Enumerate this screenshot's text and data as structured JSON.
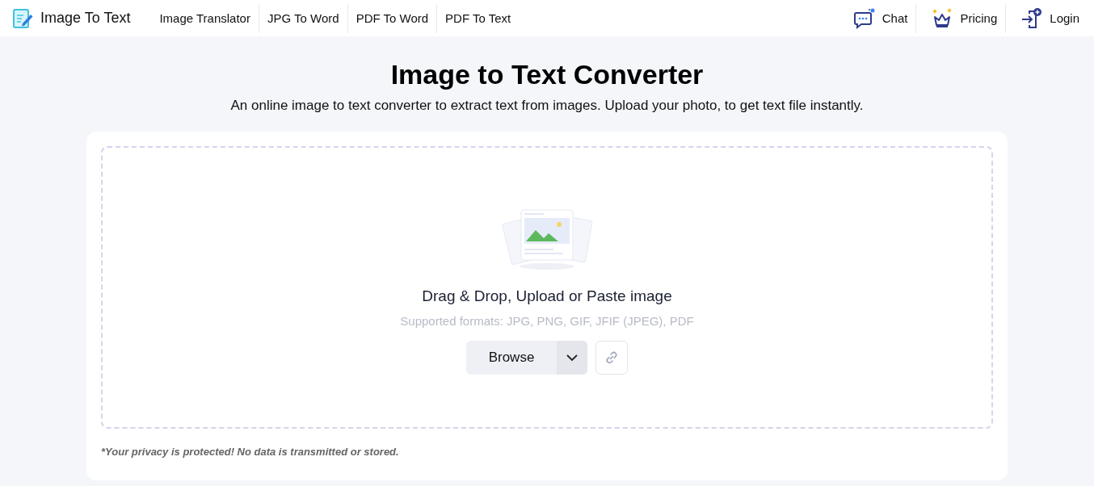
{
  "header": {
    "logo_text": "Image To Text",
    "nav": [
      {
        "label": "Image Translator"
      },
      {
        "label": "JPG To Word"
      },
      {
        "label": "PDF To Word"
      },
      {
        "label": "PDF To Text"
      }
    ],
    "actions": [
      {
        "kind": "chat",
        "label": "Chat"
      },
      {
        "kind": "pricing",
        "label": "Pricing"
      },
      {
        "kind": "login",
        "label": "Login"
      }
    ]
  },
  "hero": {
    "title": "Image to Text Converter",
    "subtitle": "An online image to text converter to extract text from images. Upload your photo, to get text file instantly."
  },
  "upload": {
    "prompt": "Drag & Drop, Upload or Paste image",
    "formats": "Supported formats: JPG, PNG, GIF, JFIF (JPEG), PDF",
    "browse": "Browse",
    "privacy": "*Your privacy is protected! No data is transmitted or stored."
  }
}
